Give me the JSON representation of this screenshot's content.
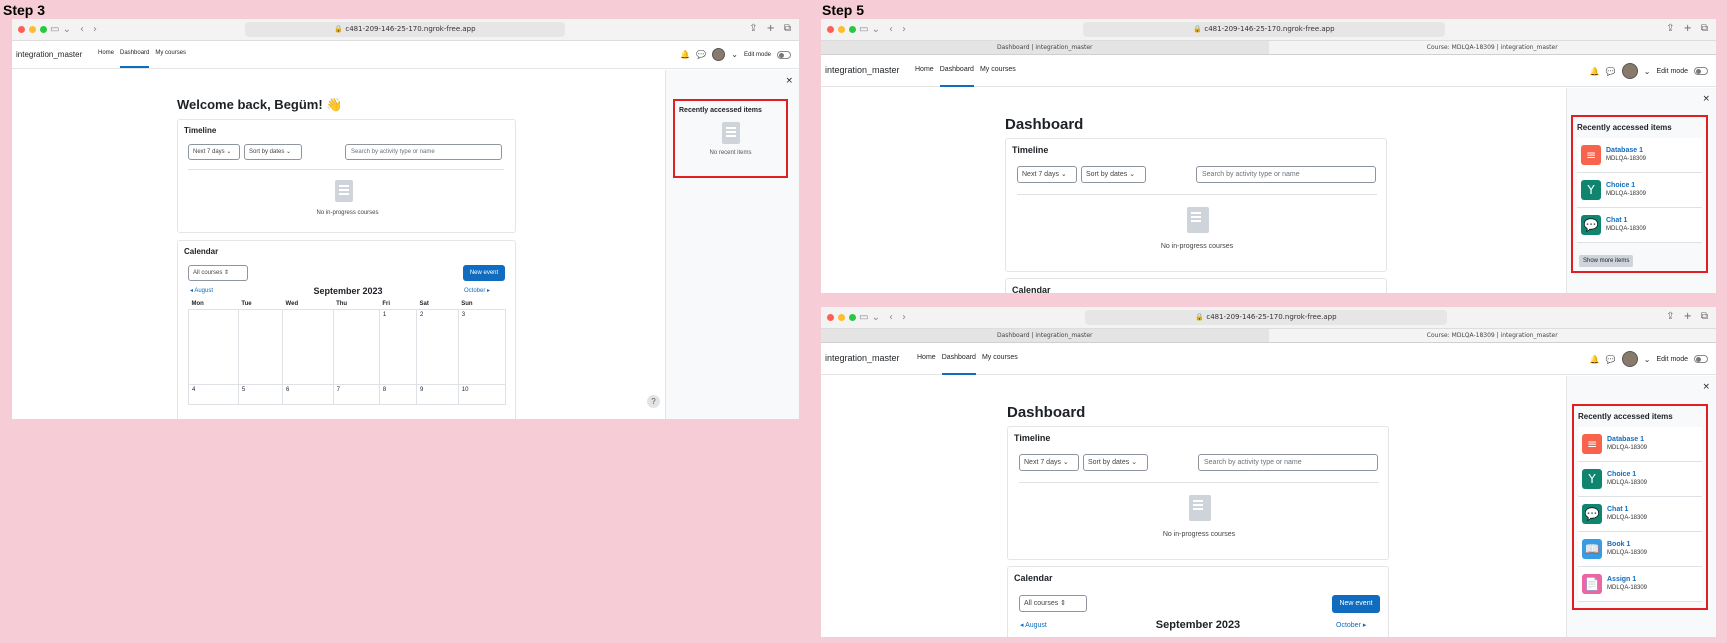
{
  "labels": {
    "step3": "Step 3",
    "step5": "Step 5"
  },
  "browser": {
    "url": "c481-209-146-25-170.ngrok-free.app",
    "tab_dashboard": "Dashboard | integration_master",
    "tab_course": "Course: MDLQA-18309 | integration_master"
  },
  "nav": {
    "site_name": "integration_master",
    "home": "Home",
    "dashboard": "Dashboard",
    "my_courses": "My courses",
    "edit_mode": "Edit mode"
  },
  "step3": {
    "welcome": "Welcome back, Begüm! 👋",
    "timeline_title": "Timeline",
    "filter_days": "Next 7 days ⌄",
    "filter_sort": "Sort by dates ⌄",
    "search_placeholder": "Search by activity type or name",
    "no_courses": "No in-progress courses",
    "calendar_title": "Calendar",
    "all_courses": "All courses ⇕",
    "new_event": "New event",
    "prev_month": "◂ August",
    "month": "September 2023",
    "next_month": "October ▸",
    "days": [
      "Mon",
      "Tue",
      "Wed",
      "Thu",
      "Fri",
      "Sat",
      "Sun"
    ],
    "week1": [
      "",
      "",
      "",
      "",
      "1",
      "2",
      "3"
    ],
    "week2": [
      "4",
      "5",
      "6",
      "7",
      "8",
      "9",
      "10"
    ],
    "rai_title": "Recently accessed items",
    "rai_empty": "No recent items",
    "help": "?"
  },
  "step5": {
    "dashboard_title": "Dashboard",
    "timeline_title": "Timeline",
    "filter_days": "Next 7 days ⌄",
    "filter_sort": "Sort by dates ⌄",
    "search_placeholder": "Search by activity type or name",
    "no_courses": "No in-progress courses",
    "calendar_title": "Calendar",
    "all_courses": "All courses ⇕",
    "new_event": "New event",
    "prev_month": "◂ August",
    "month": "September 2023",
    "next_month": "October ▸",
    "rai_title": "Recently accessed items",
    "show_more": "Show more items",
    "course": "MDLQA-18309",
    "items_a": [
      {
        "name": "Database 1",
        "icon": "database-icon",
        "color": "#f7634d",
        "glyph": "≡"
      },
      {
        "name": "Choice 1",
        "icon": "choice-icon",
        "color": "#0f8570",
        "glyph": "Y"
      },
      {
        "name": "Chat 1",
        "icon": "chat-icon",
        "color": "#0f8570",
        "glyph": "💬"
      }
    ],
    "items_b": [
      {
        "name": "Database 1",
        "icon": "database-icon",
        "color": "#f7634d",
        "glyph": "≡"
      },
      {
        "name": "Choice 1",
        "icon": "choice-icon",
        "color": "#0f8570",
        "glyph": "Y"
      },
      {
        "name": "Chat 1",
        "icon": "chat-icon",
        "color": "#0f8570",
        "glyph": "💬"
      },
      {
        "name": "Book 1",
        "icon": "book-icon",
        "color": "#399be2",
        "glyph": "📖"
      },
      {
        "name": "Assign 1",
        "icon": "assign-icon",
        "color": "#eb66a2",
        "glyph": "📄"
      }
    ]
  },
  "colors": {
    "background": "#f6cdd6",
    "primary": "#0f6cbf",
    "highlight": "#e02020"
  }
}
